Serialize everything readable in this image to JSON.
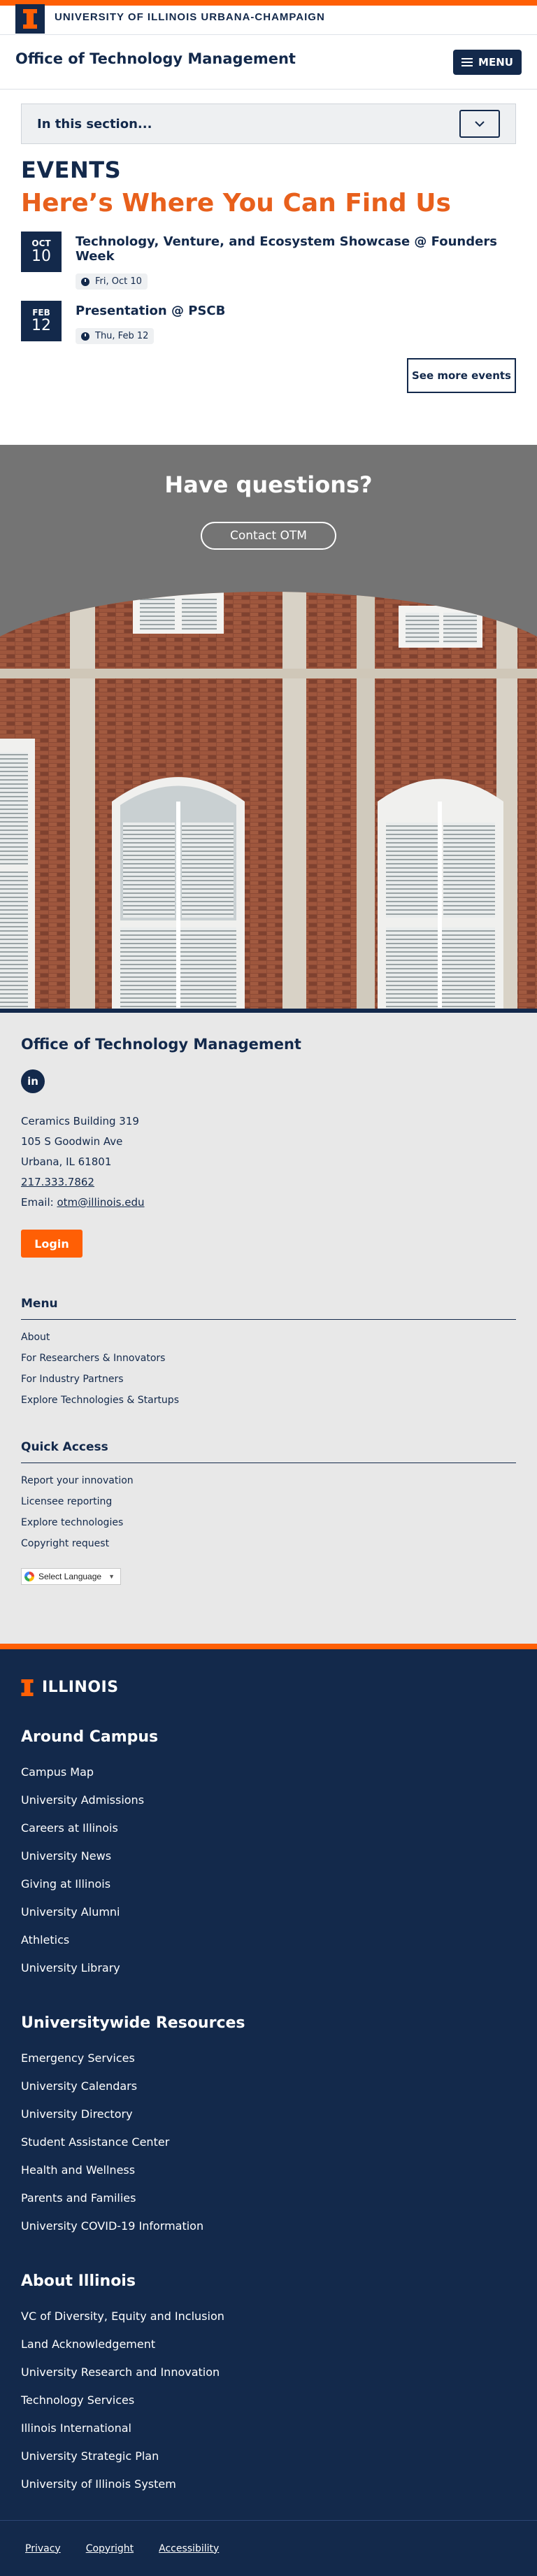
{
  "university_bar": {
    "name": "UNIVERSITY OF ILLINOIS URBANA-CHAMPAIGN",
    "logo_letter": "I"
  },
  "unit_header": {
    "title": "Office of Technology Management",
    "menu_label": "MENU"
  },
  "section_nav": {
    "label": "In this section..."
  },
  "events": {
    "heading": "EVENTS",
    "subheading": "Here’s Where You Can Find Us",
    "items": [
      {
        "month": "OCT",
        "day": "10",
        "title": "Technology, Venture, and Ecosystem Showcase @ Founders Week",
        "date": "Fri, Oct 10"
      },
      {
        "month": "FEB",
        "day": "12",
        "title": "Presentation @ PSCB",
        "date": "Thu, Feb 12"
      }
    ],
    "see_more_label": "See more events"
  },
  "questions": {
    "title": "Have questions?",
    "button_label": "Contact OTM"
  },
  "footer_unit": {
    "title": "Office of Technology Management",
    "social": "in",
    "address_lines": [
      "Ceramics Building 319",
      "105 S Goodwin Ave",
      "Urbana, IL 61801"
    ],
    "phone": "217.333.7862",
    "email_label": "Email: ",
    "email": "otm@illinois.edu",
    "login_label": "Login",
    "menu_title": "Menu",
    "menu_items": [
      "About",
      "For Researchers & Innovators",
      "For Industry Partners",
      "Explore Technologies & Startups"
    ],
    "quick_title": "Quick Access",
    "quick_items": [
      "Report your innovation",
      "Licensee reporting",
      "Explore technologies",
      "Copyright request"
    ],
    "translate_label": "Select Language"
  },
  "footer_campus": {
    "wordmark": "ILLINOIS",
    "around_title": "Around Campus",
    "around_items": [
      "Campus Map",
      "University Admissions",
      "Careers at Illinois",
      "University News",
      "Giving at Illinois",
      "University Alumni",
      "Athletics",
      "University Library"
    ],
    "resources_title": "Universitywide Resources",
    "resources_items": [
      "Emergency Services",
      "University Calendars",
      "University Directory",
      "Student Assistance Center",
      "Health and Wellness",
      "Parents and Families",
      "University COVID-19 Information"
    ],
    "about_title": "About Illinois",
    "about_items": [
      "VC of Diversity, Equity and Inclusion",
      "Land Acknowledgement",
      "University Research and Innovation",
      "Technology Services",
      "Illinois International",
      "University Strategic Plan",
      "University of Illinois System"
    ],
    "bottom_links": [
      "Privacy",
      "Copyright",
      "Accessibility"
    ]
  },
  "colors": {
    "navy": "#13294b",
    "orange": "#ff5f05",
    "heading_orange": "#e8601c"
  },
  "icons": [
    "block-i-logo-icon",
    "hamburger-icon",
    "chevron-down-icon",
    "clock-icon",
    "linkedin-icon",
    "google-icon"
  ]
}
